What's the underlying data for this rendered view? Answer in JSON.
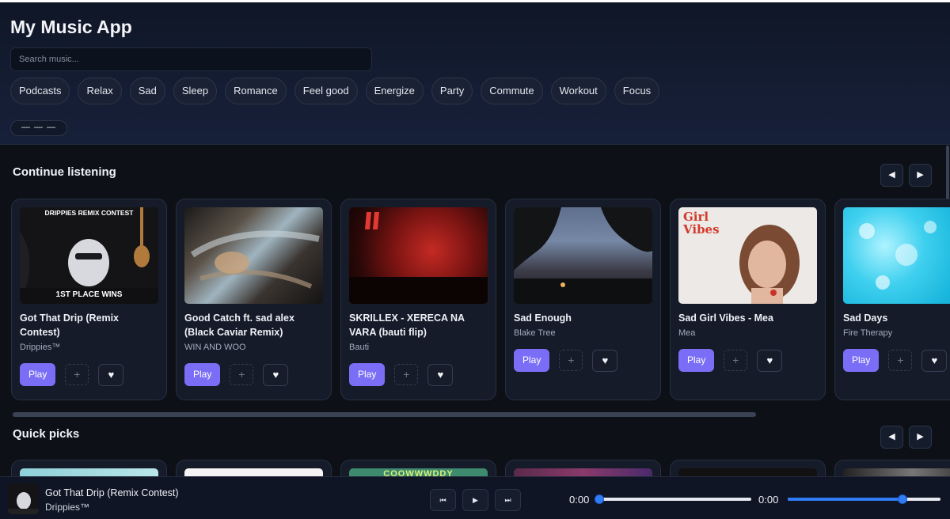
{
  "app": {
    "title": "My Music App"
  },
  "search": {
    "placeholder": "Search music..."
  },
  "moods": [
    "Podcasts",
    "Relax",
    "Sad",
    "Sleep",
    "Romance",
    "Feel good",
    "Energize",
    "Party",
    "Commute",
    "Workout",
    "Focus"
  ],
  "mini_button": {
    "label": "— — —"
  },
  "continue_listening": {
    "title": "Continue listening",
    "prev_icon": "◀",
    "next_icon": "▶",
    "items": [
      {
        "title": "Got That Drip (Remix Contest)",
        "artist": "Drippies™",
        "cover_text": "DRIPPIES REMIX CONTEST",
        "cover_sub": "1ST PLACE WINS"
      },
      {
        "title": "Good Catch ft. sad alex (Black Caviar Remix)",
        "artist": "WIN AND WOO"
      },
      {
        "title": "SKRILLEX - XERECA NA VARA (bauti flip)",
        "artist": "Bauti"
      },
      {
        "title": "Sad Enough",
        "artist": "Blake Tree"
      },
      {
        "title": "Sad Girl Vibes - Mea",
        "artist": "Mea",
        "cover_text": "Girl Vibes"
      },
      {
        "title": "Sad Days",
        "artist": "Fire Therapy"
      }
    ],
    "play_label": "Play",
    "add_label": "+",
    "heart_icon": "♥"
  },
  "quick_picks": {
    "title": "Quick picks",
    "prev_icon": "◀",
    "next_icon": "▶",
    "cover_texts": [
      "",
      "",
      "COOWWWDDY",
      "",
      "",
      ""
    ]
  },
  "player": {
    "title": "Got That Drip (Remix Contest)",
    "artist": "Drippies™",
    "prev_icon": "⏮",
    "play_icon": "▶",
    "next_icon": "⏭",
    "current_time": "0:00",
    "duration": "0:00",
    "progress": 0,
    "volume": 0.75
  },
  "colors": {
    "accent": "#7b6ef6",
    "slider": "#2f7cf6"
  }
}
